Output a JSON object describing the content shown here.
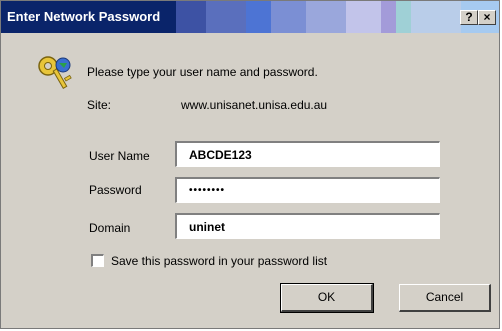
{
  "titlebar": {
    "title": "Enter Network Password",
    "help_label": "?",
    "close_label": "×"
  },
  "dialog": {
    "prompt": "Please type your user name and password.",
    "site_label": "Site:",
    "site_value": "www.unisanet.unisa.edu.au",
    "username_label": "User Name",
    "username_value": "ABCDE123",
    "password_label": "Password",
    "password_value": "••••••••",
    "domain_label": "Domain",
    "domain_value": "uninet",
    "save_password_label": "Save this password in your password list",
    "save_password_checked": false
  },
  "buttons": {
    "ok_label": "OK",
    "cancel_label": "Cancel"
  },
  "icons": {
    "key_icon": "key-icon",
    "help_icon": "help-icon",
    "close_icon": "close-icon"
  }
}
